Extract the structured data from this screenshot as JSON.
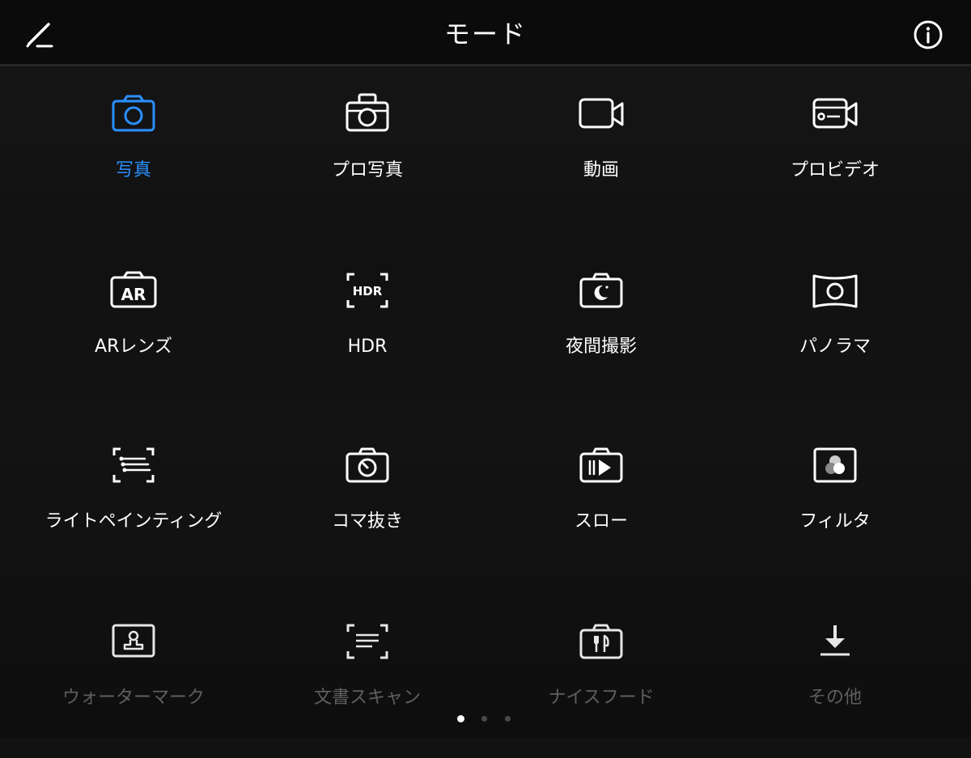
{
  "header": {
    "title": "モード"
  },
  "modes": [
    {
      "label": "写真",
      "icon": "camera-icon",
      "selected": true
    },
    {
      "label": "プロ写真",
      "icon": "pro-camera-icon"
    },
    {
      "label": "動画",
      "icon": "video-camera-icon"
    },
    {
      "label": "プロビデオ",
      "icon": "pro-video-icon"
    },
    {
      "label": "ARレンズ",
      "icon": "ar-lens-icon"
    },
    {
      "label": "HDR",
      "icon": "hdr-icon"
    },
    {
      "label": "夜間撮影",
      "icon": "night-mode-icon"
    },
    {
      "label": "パノラマ",
      "icon": "panorama-icon"
    },
    {
      "label": "ライトペインティング",
      "icon": "light-painting-icon"
    },
    {
      "label": "コマ抜き",
      "icon": "time-lapse-icon"
    },
    {
      "label": "スロー",
      "icon": "slow-motion-icon"
    },
    {
      "label": "フィルタ",
      "icon": "filter-icon"
    },
    {
      "label": "ウォーターマーク",
      "icon": "watermark-icon"
    },
    {
      "label": "文書スキャン",
      "icon": "document-scan-icon"
    },
    {
      "label": "ナイスフード",
      "icon": "food-icon"
    },
    {
      "label": "その他",
      "icon": "download-more-icon"
    }
  ],
  "pager": {
    "pages": 3,
    "current": 1
  },
  "colors": {
    "accent": "#2a90ff",
    "background": "#121212",
    "dim_label": "#5f5f5f"
  }
}
